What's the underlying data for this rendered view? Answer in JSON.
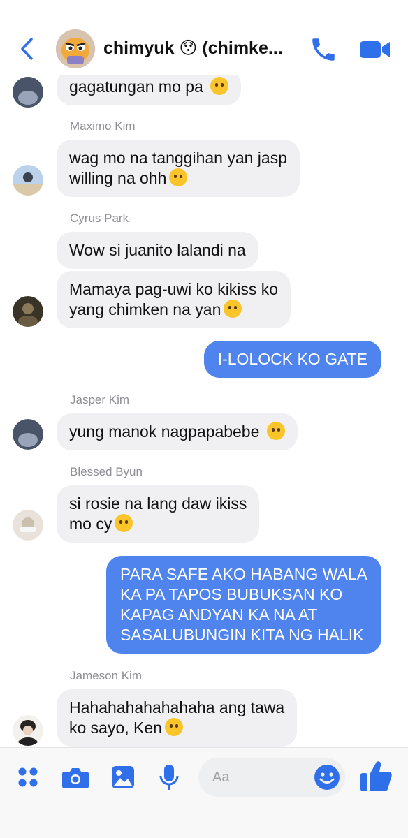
{
  "header": {
    "title": "chimyuk 😯 (chimke...",
    "back_icon": "chevron-left-icon",
    "call_icon": "phone-icon",
    "video_icon": "video-camera-icon"
  },
  "accent": "#4f83ee",
  "messages": [
    {
      "sender": "",
      "text": "gagatungan mo pa",
      "emoji": "crying-face"
    },
    {
      "sender": "Maximo Kim",
      "line1": "wag mo na tanggihan yan jasp",
      "line2": "willing na ohh",
      "emoji": "tears-of-joy"
    },
    {
      "sender": "Cyrus Park",
      "text": "Wow si juanito lalandi na"
    },
    {
      "line1": "Mamaya pag-uwi ko kikiss ko",
      "line2": "yang chimken na yan",
      "emoji": "kissing-face"
    },
    {
      "outgoing": true,
      "text": "I-LOLOCK KO GATE"
    },
    {
      "sender": "Jasper Kim",
      "text": "yung manok nagpapabebe",
      "emoji": "rolling-laughing"
    },
    {
      "sender": "Blessed Byun",
      "line1": "si rosie na lang daw ikiss",
      "line2": "mo cy",
      "emoji": "sneezing-face"
    },
    {
      "outgoing": true,
      "lines": [
        "PARA SAFE AKO HABANG WALA",
        "KA PA TAPOS BUBUKSAN KO",
        "KAPAG ANDYAN KA NA AT",
        "SASALUBUNGIN KITA NG HALIK"
      ]
    },
    {
      "sender": "Jameson Kim",
      "line1": "Hahahahahahahaha ang tawa",
      "line2": "ko sayo, Ken",
      "emoji": "rolling-laughing"
    }
  ],
  "composer": {
    "placeholder": "Aa",
    "icons": [
      "apps-icon",
      "camera-icon",
      "gallery-icon",
      "microphone-icon",
      "emoji-icon",
      "thumbs-up-icon"
    ]
  }
}
